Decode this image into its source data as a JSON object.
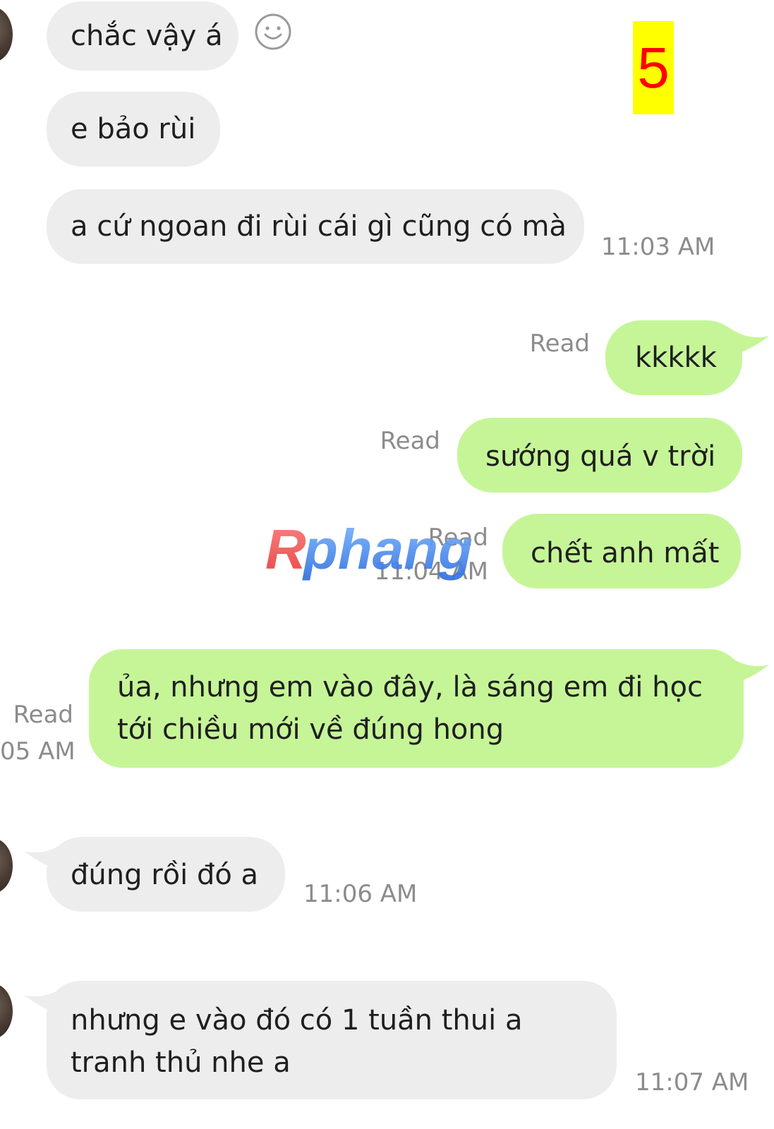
{
  "conversation": {
    "messages": [
      {
        "from": "them",
        "text": "chắc vậy á"
      },
      {
        "from": "them",
        "text": "e bảo rùi"
      },
      {
        "from": "them",
        "text": "a cứ ngoan đi rùi cái gì cũng có mà",
        "time": "11:03 AM"
      },
      {
        "from": "me",
        "text": "kkkkk",
        "status": "Read"
      },
      {
        "from": "me",
        "text": "sướng quá v trời",
        "status": "Read"
      },
      {
        "from": "me",
        "text": "chết anh mất",
        "status": "Read",
        "time": "11:04 AM"
      },
      {
        "from": "me",
        "lines": [
          "ủa, nhưng em vào đây, là sáng em đi học",
          "tới chiều mới về đúng hong"
        ],
        "status": "Read",
        "time": "05 AM"
      },
      {
        "from": "them",
        "text": "đúng rồi đó a",
        "time": "11:06 AM"
      },
      {
        "from": "them",
        "lines": [
          "nhưng e vào đó có 1 tuần thui a",
          "tranh thủ nhe a"
        ],
        "time": "11:07 AM"
      }
    ]
  },
  "overlay": {
    "page_number": "5",
    "watermark": "Rphang"
  },
  "colors": {
    "incoming_bubble": "#ededed",
    "outgoing_bubble": "#c6f598",
    "meta_text": "#8c8c8c",
    "badge_bg": "#ffff00",
    "badge_text": "#ff0000"
  },
  "icons": [
    "emoji-smile-icon",
    "avatar"
  ]
}
